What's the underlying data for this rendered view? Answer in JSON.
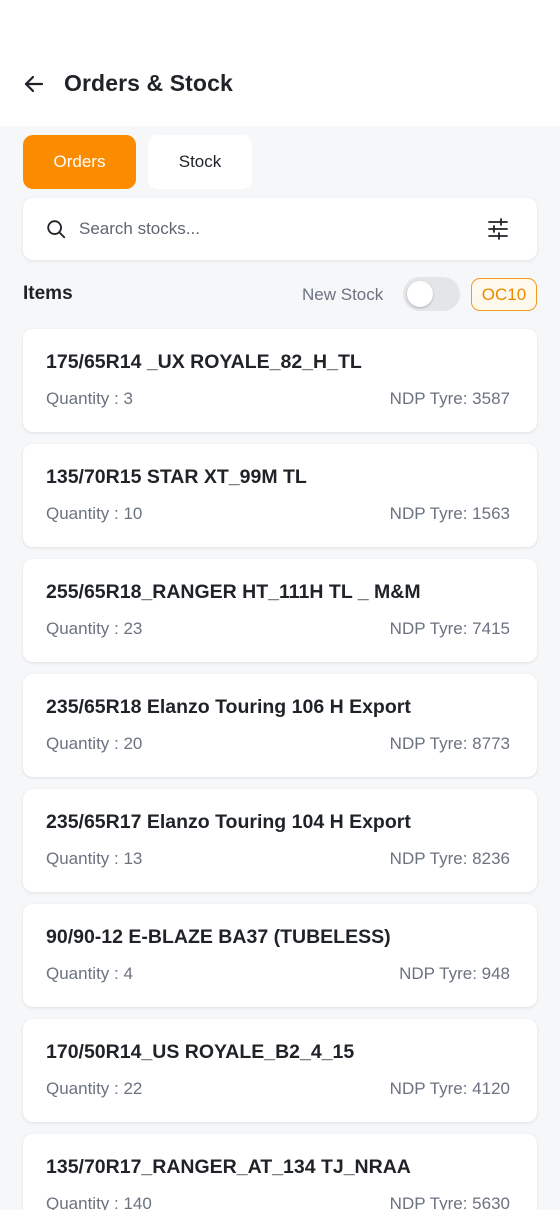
{
  "header": {
    "title": "Orders & Stock"
  },
  "tabs": [
    {
      "label": "Orders",
      "active": true
    },
    {
      "label": "Stock",
      "active": false
    }
  ],
  "search": {
    "placeholder": "Search stocks...",
    "value": ""
  },
  "items_bar": {
    "label": "Items",
    "new_stock_label": "New Stock",
    "new_stock_on": false,
    "badge": "OC10"
  },
  "products": [
    {
      "name": "175/65R14 _UX ROYALE_82_H_TL",
      "quantity": "Quantity : 3",
      "ndp": "NDP Tyre: 3587"
    },
    {
      "name": "135/70R15 STAR XT_99M TL",
      "quantity": "Quantity : 10",
      "ndp": "NDP Tyre: 1563"
    },
    {
      "name": "255/65R18_RANGER HT_111H TL _ M&M",
      "quantity": "Quantity : 23",
      "ndp": "NDP Tyre: 7415"
    },
    {
      "name": "235/65R18 Elanzo Touring 106 H Export",
      "quantity": "Quantity : 20",
      "ndp": "NDP Tyre: 8773"
    },
    {
      "name": "235/65R17 Elanzo Touring 104 H Export",
      "quantity": "Quantity : 13",
      "ndp": "NDP Tyre: 8236"
    },
    {
      "name": "90/90-12 E-BLAZE BA37 (TUBELESS)",
      "quantity": "Quantity : 4",
      "ndp": "NDP Tyre: 948"
    },
    {
      "name": "170/50R14_US ROYALE_B2_4_15",
      "quantity": "Quantity : 22",
      "ndp": "NDP Tyre: 4120"
    },
    {
      "name": "135/70R17_RANGER_AT_134 TJ_NRAA",
      "quantity": "Quantity : 140",
      "ndp": "NDP Tyre: 5630"
    }
  ],
  "colors": {
    "accent": "#fb8c00",
    "badge_border": "#f29b1d",
    "background": "#f6f7f9",
    "card": "#ffffff",
    "muted_text": "#6b7280"
  },
  "icons": {
    "back": "arrow-left-icon",
    "search": "search-icon",
    "filter": "sliders-icon"
  }
}
